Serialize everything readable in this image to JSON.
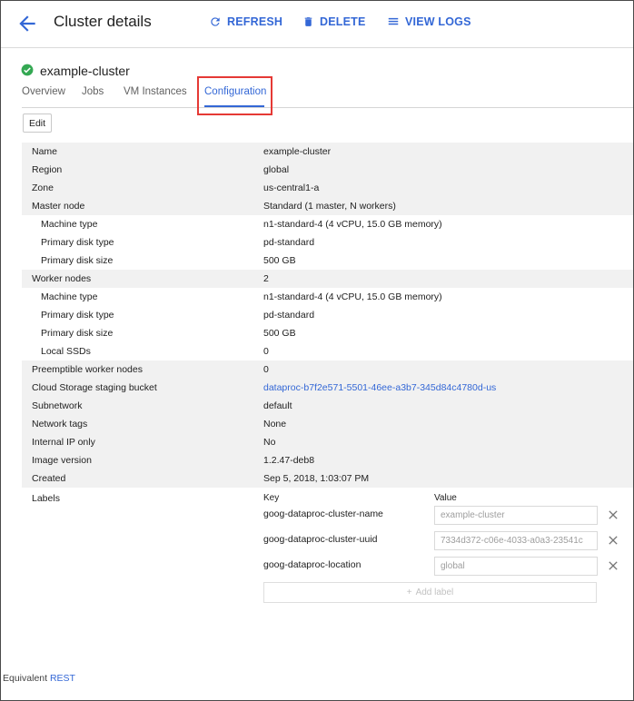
{
  "header": {
    "title": "Cluster details",
    "refresh_label": "REFRESH",
    "delete_label": "DELETE",
    "view_logs_label": "VIEW LOGS"
  },
  "cluster": {
    "name": "example-cluster",
    "status_icon": "check-circle-icon",
    "status_color": "#34a853"
  },
  "tabs": [
    {
      "label": "Overview"
    },
    {
      "label": "Jobs"
    },
    {
      "label": "VM Instances"
    },
    {
      "label": "Configuration",
      "active": true
    }
  ],
  "edit_label": "Edit",
  "config_rows": [
    {
      "key": "Name",
      "value": "example-cluster"
    },
    {
      "key": "Region",
      "value": "global"
    },
    {
      "key": "Zone",
      "value": "us-central1-a"
    },
    {
      "key": "Master node",
      "value": "Standard (1 master, N workers)"
    },
    {
      "key": "Machine type",
      "value": "n1-standard-4 (4 vCPU, 15.0 GB memory)"
    },
    {
      "key": "Primary disk type",
      "value": "pd-standard"
    },
    {
      "key": "Primary disk size",
      "value": "500 GB"
    },
    {
      "key": "Worker nodes",
      "value": "2"
    },
    {
      "key": "Machine type",
      "value": "n1-standard-4 (4 vCPU, 15.0 GB memory)"
    },
    {
      "key": "Primary disk type",
      "value": "pd-standard"
    },
    {
      "key": "Primary disk size",
      "value": "500 GB"
    },
    {
      "key": "Local SSDs",
      "value": "0"
    },
    {
      "key": "Preemptible worker nodes",
      "value": "0"
    },
    {
      "key": "Cloud Storage staging bucket",
      "value": "dataproc-b7f2e571-5501-46ee-a3b7-345d84c4780d-us"
    },
    {
      "key": "Subnetwork",
      "value": "default"
    },
    {
      "key": "Network tags",
      "value": "None"
    },
    {
      "key": "Internal IP only",
      "value": "No"
    },
    {
      "key": "Image version",
      "value": "1.2.47-deb8"
    },
    {
      "key": "Created",
      "value": "Sep 5, 2018, 1:03:07 PM"
    }
  ],
  "labels": {
    "title": "Labels",
    "key_header": "Key",
    "value_header": "Value",
    "items": [
      {
        "key": "goog-dataproc-cluster-name",
        "value": "example-cluster"
      },
      {
        "key": "goog-dataproc-cluster-uuid",
        "value": "7334d372-c06e-4033-a0a3-23541c"
      },
      {
        "key": "goog-dataproc-location",
        "value": "global"
      }
    ],
    "add_label": "Add label"
  },
  "footer": {
    "prefix": "Equivalent",
    "link": "REST"
  },
  "colors": {
    "accent": "#3367d6",
    "highlight": "#e53935"
  }
}
